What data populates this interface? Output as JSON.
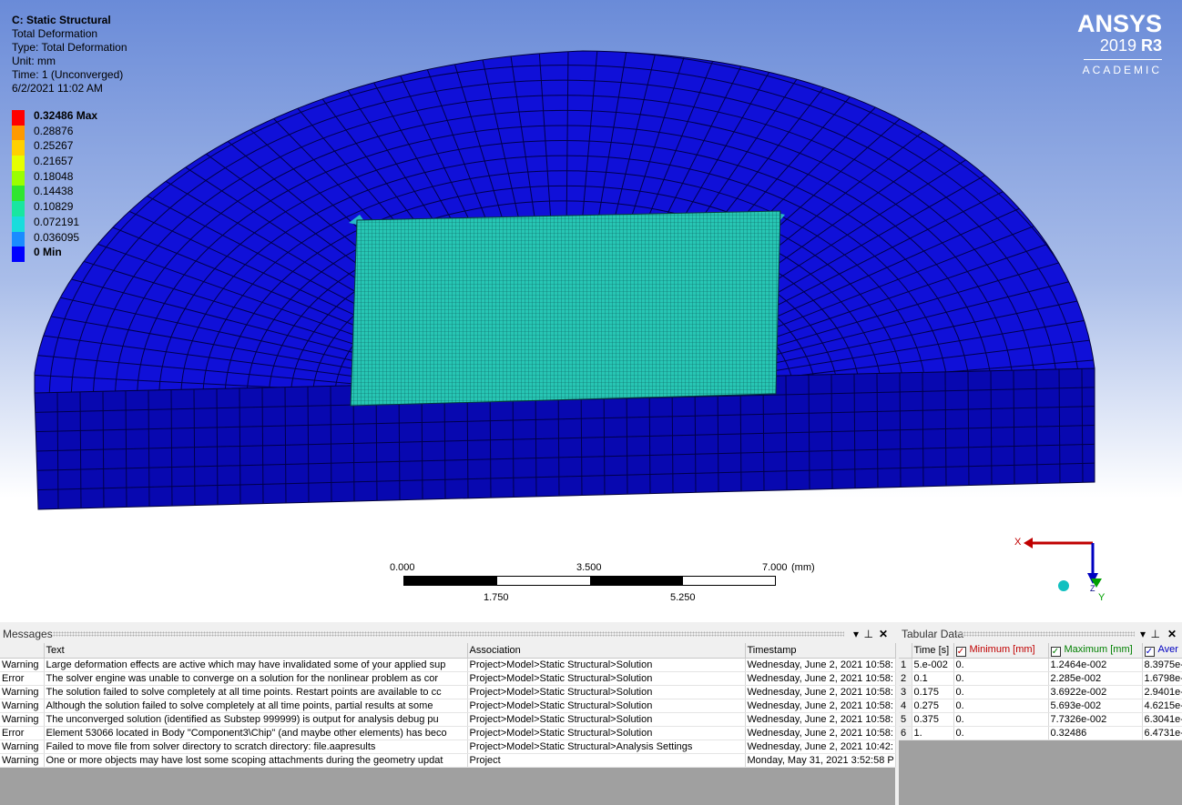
{
  "header": {
    "title": "C: Static Structural",
    "lines": [
      "Total Deformation",
      "Type: Total Deformation",
      "Unit: mm",
      "Time: 1 (Unconverged)",
      "6/2/2021 11:02 AM"
    ]
  },
  "legend": {
    "items": [
      {
        "label": "0.32486 Max",
        "color": "#ff0000",
        "bold": true
      },
      {
        "label": "0.28876",
        "color": "#ff9a00"
      },
      {
        "label": "0.25267",
        "color": "#ffd000"
      },
      {
        "label": "0.21657",
        "color": "#e6ff00"
      },
      {
        "label": "0.18048",
        "color": "#9aff00"
      },
      {
        "label": "0.14438",
        "color": "#2fe62f"
      },
      {
        "label": "0.10829",
        "color": "#19e6a0"
      },
      {
        "label": "0.072191",
        "color": "#19dcdc"
      },
      {
        "label": "0.036095",
        "color": "#1a8cff"
      },
      {
        "label": "0 Min",
        "color": "#0000ff",
        "bold": true
      }
    ]
  },
  "logo": {
    "brand": "ANSYS",
    "version": "2019",
    "release": "R3",
    "edition": "ACADEMIC"
  },
  "scale": {
    "top_labels": [
      "0.000",
      "3.500",
      "7.000"
    ],
    "unit": "(mm)",
    "bottom_labels": [
      "1.750",
      "5.250"
    ]
  },
  "triad": {
    "x": "X",
    "y": "Y",
    "z": "Z"
  },
  "messages": {
    "title": "Messages",
    "columns": [
      "",
      "Text",
      "Association",
      "Timestamp"
    ],
    "rows": [
      [
        "Warning",
        "Large deformation effects are active which may have invalidated some of your applied sup",
        "Project>Model>Static Structural>Solution",
        "Wednesday, June 2, 2021 10:58:"
      ],
      [
        "Error",
        "The solver engine was unable to converge on a solution for the nonlinear problem as cor",
        "Project>Model>Static Structural>Solution",
        "Wednesday, June 2, 2021 10:58:"
      ],
      [
        "Warning",
        "The solution failed to solve completely at all time points. Restart points are available to cc",
        "Project>Model>Static Structural>Solution",
        "Wednesday, June 2, 2021 10:58:"
      ],
      [
        "Warning",
        "Although the solution failed to solve completely at all time points, partial results at some",
        "Project>Model>Static Structural>Solution",
        "Wednesday, June 2, 2021 10:58:"
      ],
      [
        "Warning",
        "The unconverged solution (identified as Substep 999999) is output for analysis debug pu",
        "Project>Model>Static Structural>Solution",
        "Wednesday, June 2, 2021 10:58:"
      ],
      [
        "Error",
        "Element 53066 located in Body \"Component3\\Chip\" (and maybe other elements) has beco",
        "Project>Model>Static Structural>Solution",
        "Wednesday, June 2, 2021 10:58:"
      ],
      [
        "Warning",
        "Failed to move file from solver directory to scratch directory: file.aapresults",
        "Project>Model>Static Structural>Analysis Settings",
        "Wednesday, June 2, 2021 10:42:"
      ],
      [
        "Warning",
        "One or more objects may have lost some scoping attachments during the geometry updat",
        "Project",
        "Monday, May 31, 2021 3:52:58 P"
      ]
    ]
  },
  "tabular": {
    "title": "Tabular Data",
    "columns": [
      "",
      "Time [s]",
      "Minimum [mm]",
      "Maximum [mm]",
      "Aver"
    ],
    "column_colors": [
      "#000000",
      "#000000",
      "#c00000",
      "#008000",
      "#0000c0"
    ],
    "rows": [
      [
        "1",
        "5.e-002",
        "0.",
        "1.2464e-002",
        "8.3975e-"
      ],
      [
        "2",
        "0.1",
        "0.",
        "2.285e-002",
        "1.6798e-"
      ],
      [
        "3",
        "0.175",
        "0.",
        "3.6922e-002",
        "2.9401e-"
      ],
      [
        "4",
        "0.275",
        "0.",
        "5.693e-002",
        "4.6215e-"
      ],
      [
        "5",
        "0.375",
        "0.",
        "7.7326e-002",
        "6.3041e-"
      ],
      [
        "6",
        "1.",
        "0.",
        "0.32486",
        "6.4731e-"
      ]
    ]
  }
}
